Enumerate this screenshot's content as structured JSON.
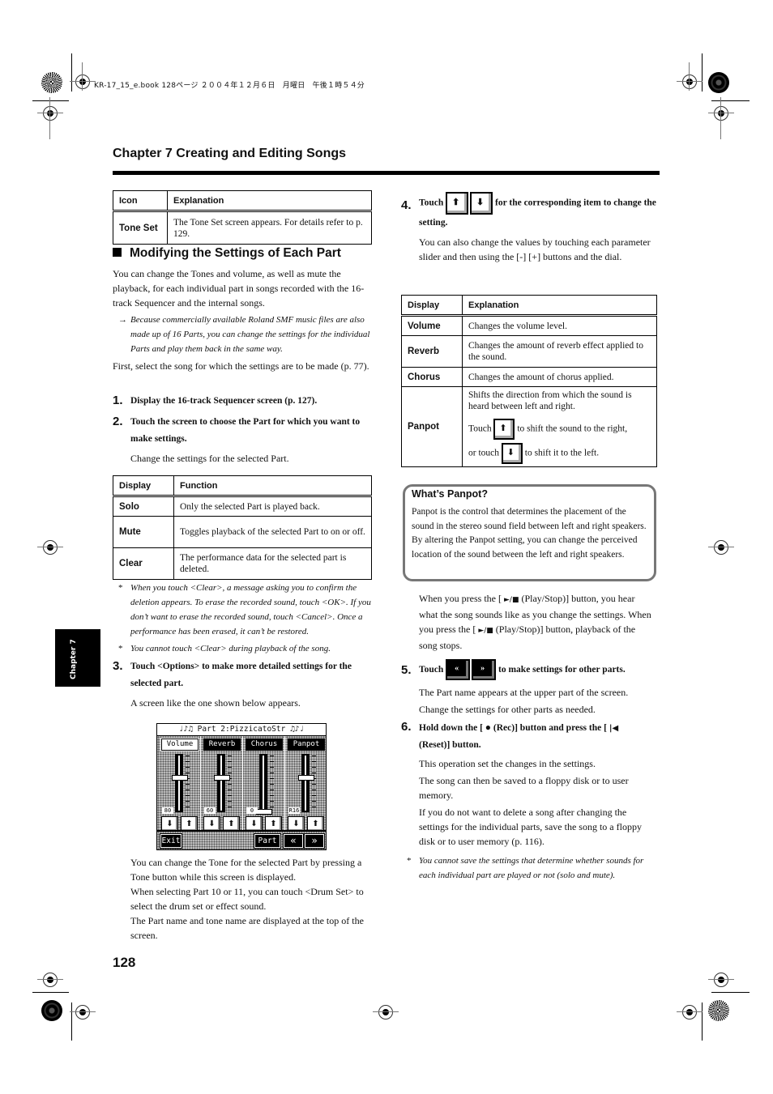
{
  "header_meta": "KR-17_15_e.book  128ページ  ２００４年１２月６日　月曜日　午後１時５４分",
  "chapter_title": "Chapter 7 Creating and Editing Songs",
  "side_tab": "Chapter 7",
  "icon_table": {
    "headers": [
      "Icon",
      "Explanation"
    ],
    "rows": [
      {
        "key": "Tone Set",
        "value": "The Tone Set screen appears. For details refer to p. 129."
      }
    ]
  },
  "section_heading": "Modifying the Settings of Each Part",
  "intro": "You can change the Tones and volume, as well as mute the playback, for each individual part in songs recorded with the 16-track Sequencer and the internal songs.",
  "arrow_note": "Because commercially available Roland SMF music files are also made up of 16 Parts, you can change the settings for the individual Parts and play them back in the same way.",
  "select_text": "First, select the song for which the settings are to be made (p. 77).",
  "steps": {
    "s1": {
      "num": "1.",
      "text": "Display the 16-track Sequencer screen (p. 127)."
    },
    "s2": {
      "num": "2.",
      "text": "Touch the screen to choose the Part for which you want to make settings.",
      "sub": "Change the settings for the selected Part."
    },
    "s3": {
      "num": "3.",
      "text": "Touch <Options> to make more detailed settings for the selected part.",
      "sub": "A screen like the one shown below appears."
    },
    "s4": {
      "num": "4.",
      "touch": "Touch",
      "text": "for the corresponding item to change the setting.",
      "sub": "You can also change the values by touching each parameter slider and then using the [-] [+] buttons and the dial."
    },
    "s5": {
      "num": "5.",
      "touch": "Touch",
      "text": "to make settings for other parts.",
      "sub1": "The Part name appears at the upper part of the screen.",
      "sub2": "Change the settings for other parts as needed."
    },
    "s6": {
      "num": "6.",
      "text_a": "Hold down the [",
      "rec_label": "(Rec)] button and press the [",
      "reset_label": "(Reset)] button.",
      "sub1": "This operation set the changes in the settings.",
      "sub2": "The song can then be saved to a floppy disk or to user memory.",
      "sub3": "If you do not want to delete a song after changing the settings for the individual parts, save the song to a floppy disk or to user memory (p. 116)."
    }
  },
  "function_table": {
    "headers": [
      "Display",
      "Function"
    ],
    "rows": [
      {
        "key": "Solo",
        "value": "Only the selected Part is played back."
      },
      {
        "key": "Mute",
        "value": "Toggles playback of the selected Part to on or off."
      },
      {
        "key": "Clear",
        "value": "The performance data for the selected part is deleted."
      }
    ]
  },
  "notes_clear": [
    "When you touch <Clear>, a message asking you to confirm the deletion appears. To erase the recorded sound, touch <OK>. If you don’t want to erase the recorded sound, touch <Cancel>. Once a performance has been erased, it can’t be restored.",
    "You cannot touch <Clear> during playback of the song."
  ],
  "lcd": {
    "title": "Part 2:PizzicatoStr",
    "columns": [
      {
        "tab": "Volume",
        "value": "80",
        "level": 0.63,
        "selected": true
      },
      {
        "tab": "Reverb",
        "value": "60",
        "level": 0.63,
        "selected": false
      },
      {
        "tab": "Chorus",
        "value": "0",
        "level": 0.0,
        "selected": false
      },
      {
        "tab": "Panpot",
        "value": "R16",
        "level": 0.63,
        "selected": false
      }
    ],
    "exit": "Exit",
    "part": "Part",
    "prev": "«",
    "next": "»"
  },
  "lcd_caption": [
    "You can change the Tone for the selected Part by pressing a Tone button while this screen is displayed.",
    "When selecting Part 10 or 11, you can touch <Drum Set> to select the drum set or effect sound.",
    "The Part name and tone name are displayed at the top of the screen."
  ],
  "explain_table": {
    "headers": [
      "Display",
      "Explanation"
    ],
    "rows": [
      {
        "key": "Volume",
        "value": "Changes the volume level."
      },
      {
        "key": "Reverb",
        "value": "Changes the amount of reverb effect applied to the sound."
      },
      {
        "key": "Chorus",
        "value": "Changes the amount of chorus applied."
      }
    ],
    "panpot": {
      "key": "Panpot",
      "value": "Shifts the direction from which the sound is heard between left and right.",
      "touch_up_a": "Touch",
      "touch_up_b": "to shift the sound to the right,",
      "touch_down_a": "or touch",
      "touch_down_b": "to shift it to the left."
    }
  },
  "callout": {
    "title": "What’s Panpot?",
    "body": "Panpot is the control that determines the placement of the sound in the stereo sound field between left and right speakers. By altering the Panpot setting, you can change the perceived location of the sound between the left and right speakers."
  },
  "play_stop_text": {
    "a": "When you press the [",
    "b": "(Play/Stop)] button, you hear what the song sounds like as you change the settings. When you press the [",
    "c": "(Play/Stop)] button, playback of the song stops.",
    "symbol": "►/■"
  },
  "save_note": "You cannot save the settings that determine whether sounds for each individual part are played or not (solo and mute).",
  "note_marker": "*",
  "arrow_marker": "→",
  "page_number": "128"
}
